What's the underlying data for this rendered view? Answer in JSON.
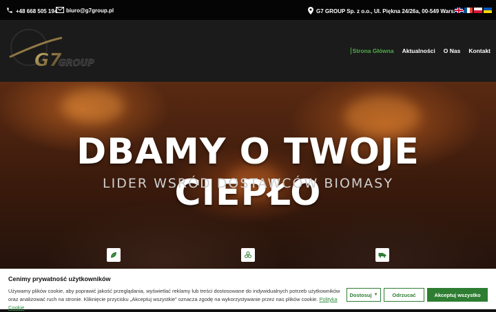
{
  "topbar": {
    "phone": "+48 668 505 194",
    "email": "biuro@g7group.pl",
    "address": "G7 GROUP Sp. z o.o.,  Ul. Piękna 24/26a, 00-549 Warszawa",
    "icons": [
      "phone-icon",
      "mail-icon",
      "location-pin-icon"
    ],
    "flags": [
      "uk-flag",
      "fr-flag",
      "pl-flag",
      "ua-flag"
    ]
  },
  "logo": {
    "text": "GROUP",
    "mark": "G7"
  },
  "nav": {
    "items": [
      "Strona Główna",
      "Aktualności",
      "O Nas",
      "Kontakt"
    ],
    "active": "Strona Główna"
  },
  "hero": {
    "title": "DBAMY O TWOJE CIEPŁO",
    "subtitle": "LIDER WSRÓD DOSTAWCÓW BIOMASY",
    "feature_icons": [
      "leaf-icon",
      "pellets-icon",
      "truck-icon"
    ]
  },
  "cookie": {
    "title": "Cenimy prywatność użytkowników",
    "text": "Używamy plików cookie, aby poprawić jakość przeglądania, wyświetlać reklamy lub treści dostosowane do indywidualnych potrzeb użytkowników oraz analizować ruch na stronie. Kliknięcie przycisku „Akceptuj wszystkie” oznacza zgodę na wykorzystywanie przez nas plików cookie.",
    "link": "Polityka Cookie",
    "buttons": {
      "customize": "Dostosuj",
      "reject": "Odrzucać",
      "accept": "Akceptuj wszystko"
    }
  },
  "colors": {
    "accent": "#4fae47",
    "button": "#2e7d32"
  }
}
